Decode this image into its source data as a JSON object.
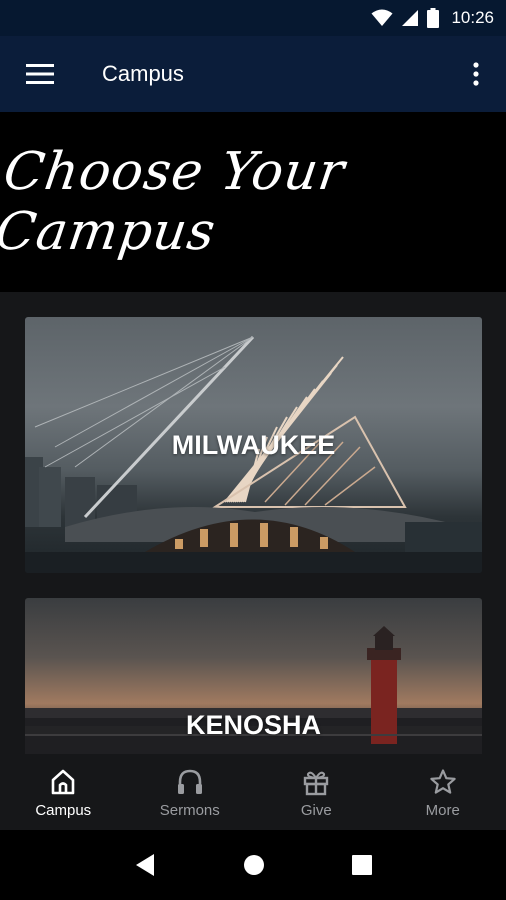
{
  "status_bar": {
    "time": "10:26"
  },
  "app_bar": {
    "title": "Campus",
    "menu_icon": "menu-icon",
    "overflow_icon": "more-vert-icon"
  },
  "banner": {
    "text": "Choose Your Campus"
  },
  "campuses": [
    {
      "name": "MILWAUKEE"
    },
    {
      "name": "KENOSHA"
    }
  ],
  "bottom_nav": {
    "items": [
      {
        "label": "Campus",
        "icon": "home-icon",
        "active": true
      },
      {
        "label": "Sermons",
        "icon": "headphones-icon",
        "active": false
      },
      {
        "label": "Give",
        "icon": "gift-icon",
        "active": false
      },
      {
        "label": "More",
        "icon": "star-icon",
        "active": false
      }
    ]
  },
  "colors": {
    "app_bar": "#0b1d3a",
    "status_bar": "#061830",
    "background": "#161719",
    "inactive": "#9a9ca0"
  }
}
